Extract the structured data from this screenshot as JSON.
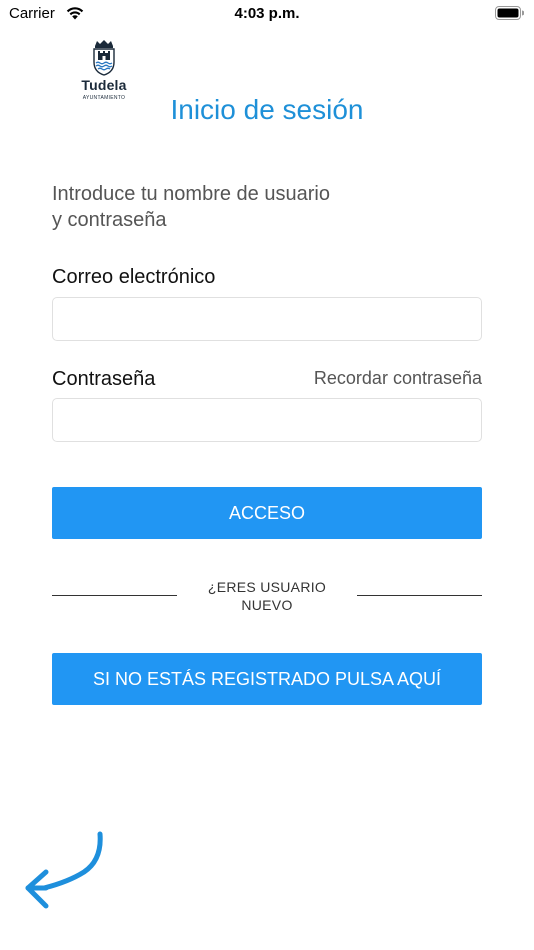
{
  "status_bar": {
    "carrier": "Carrier",
    "time": "4:03 p.m."
  },
  "logo": {
    "name": "Tudela",
    "subtitle": "AYUNTAMIENTO",
    "color": "#1b2a3a",
    "accent": "#2b78c2"
  },
  "page": {
    "title": "Inicio de sesión",
    "intro_line1": "Introduce tu nombre de usuario",
    "intro_line2": "y contraseña"
  },
  "form": {
    "email_label": "Correo electrónico",
    "email_value": "",
    "email_placeholder": "",
    "password_label": "Contraseña",
    "password_value": "",
    "password_placeholder": "",
    "forgot_label": "Recordar contraseña",
    "access_button": "ACCESO"
  },
  "new_user": {
    "line1": "¿ERES USUARIO",
    "line2": "NUEVO",
    "register_button": "SI NO ESTÁS REGISTRADO PULSA AQUÍ"
  },
  "icons": {
    "wifi": "wifi-icon",
    "battery": "battery-icon",
    "back": "back-arrow-icon",
    "shield": "coat-of-arms-icon"
  },
  "colors": {
    "title": "#1e90d8",
    "button": "#2196f3",
    "button_text": "#ffffff",
    "back_arrow": "#1e8fdc"
  }
}
